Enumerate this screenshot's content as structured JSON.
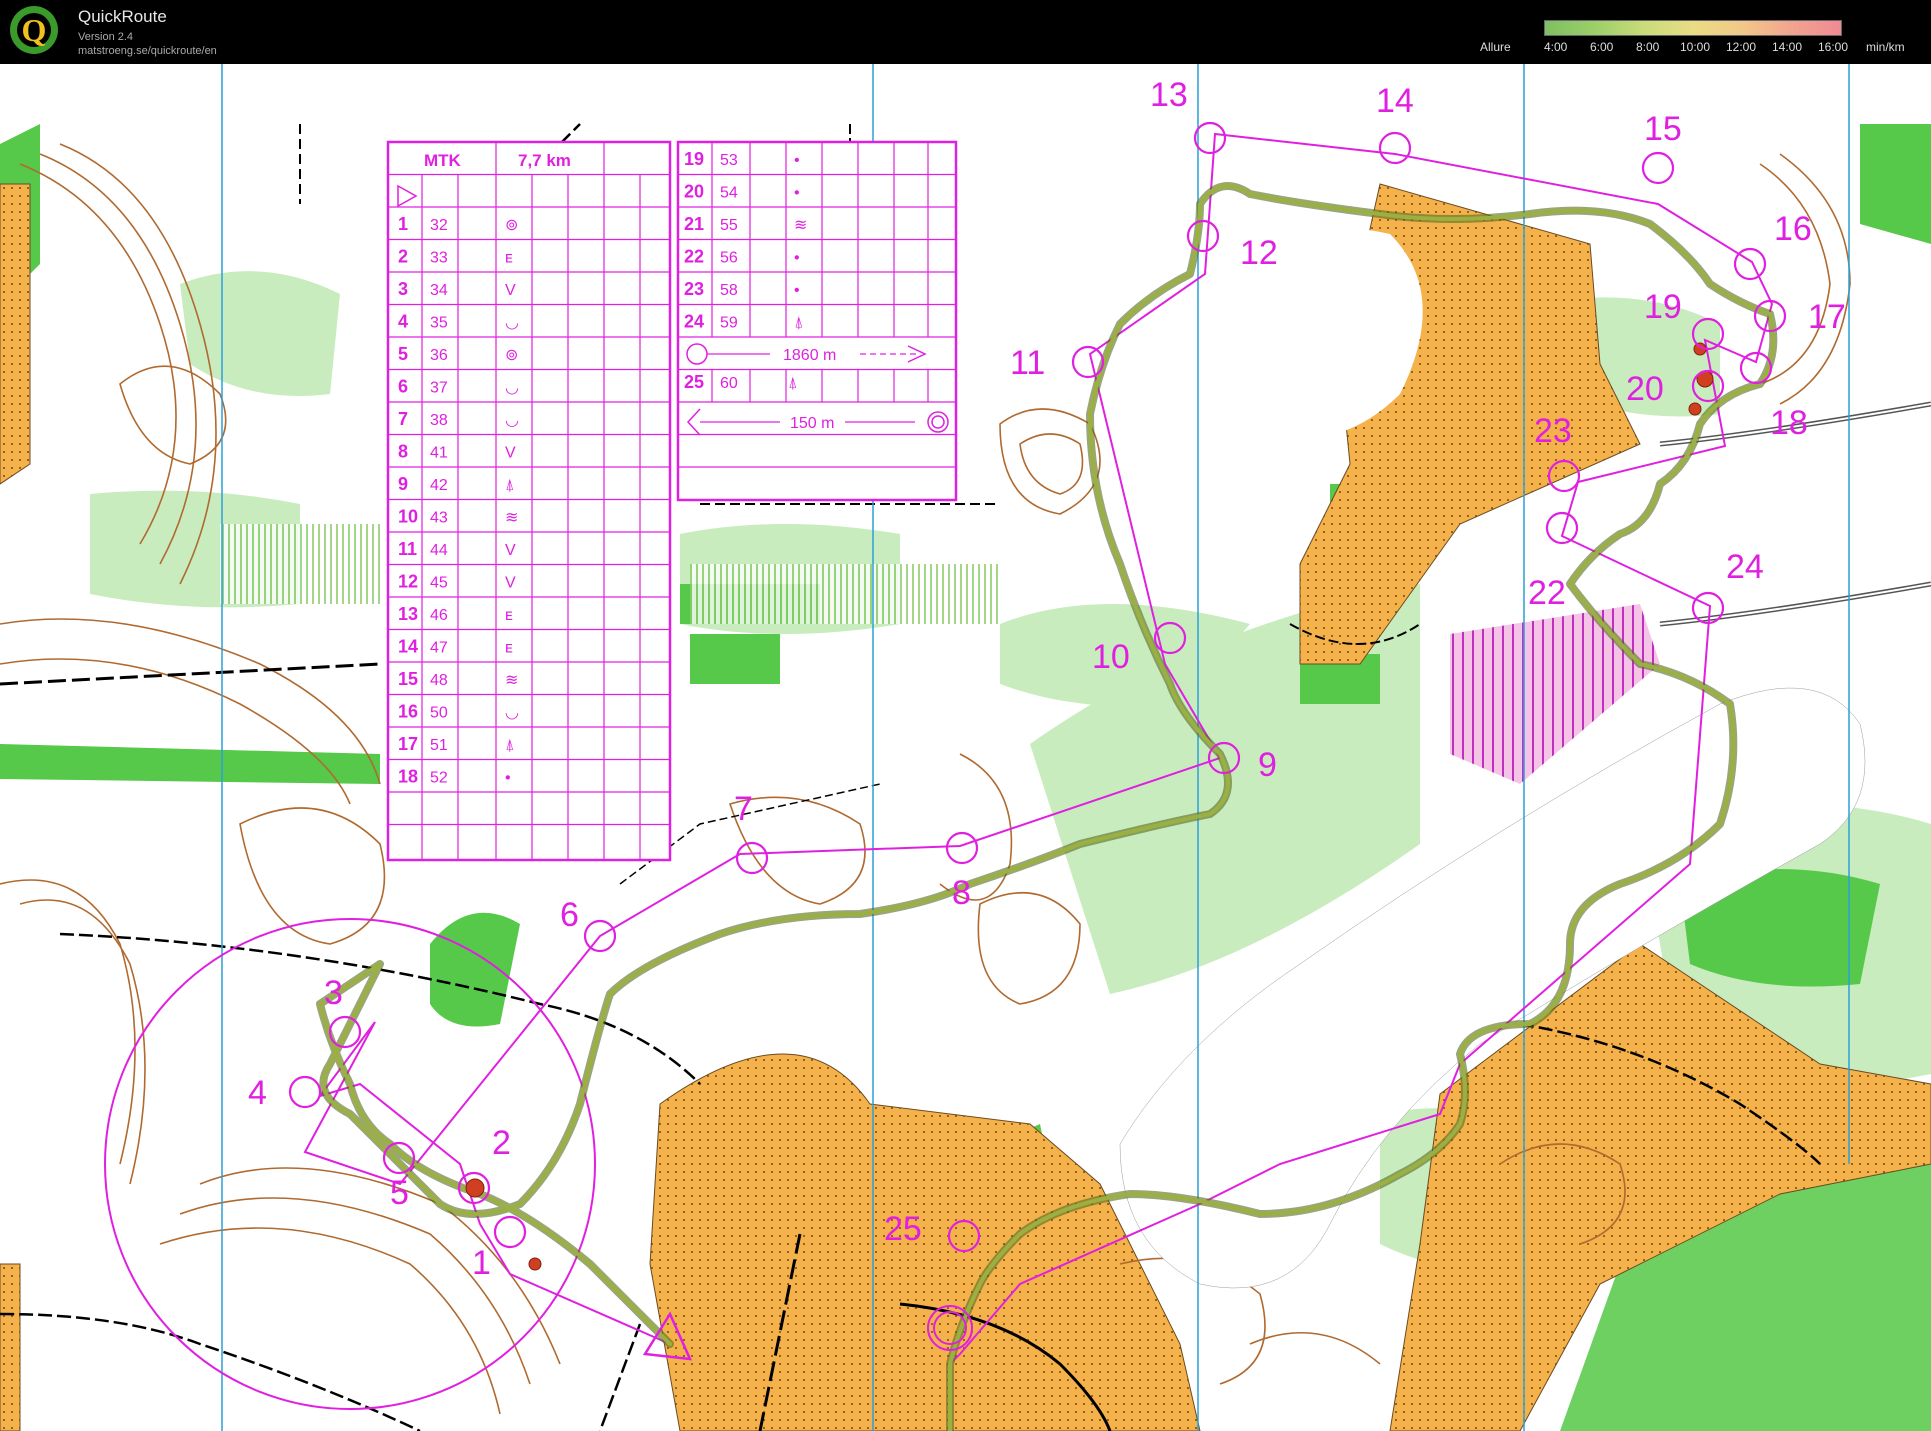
{
  "app": {
    "title": "QuickRoute",
    "version": "Version 2.4",
    "url": "matstroeng.se/quickroute/en",
    "logo_letter": "Q"
  },
  "legend": {
    "label": "Allure",
    "ticks": [
      "4:00",
      "6:00",
      "8:00",
      "10:00",
      "12:00",
      "14:00",
      "16:00"
    ],
    "unit": "min/km"
  },
  "control_card": {
    "header": {
      "class": "MTK",
      "distance": "7,7 km"
    },
    "rows_left": [
      {
        "num": "1",
        "code": "32",
        "sym": "⊚"
      },
      {
        "num": "2",
        "code": "33",
        "sym": "ᴇ"
      },
      {
        "num": "3",
        "code": "34",
        "sym": "V"
      },
      {
        "num": "4",
        "code": "35",
        "sym": "◡"
      },
      {
        "num": "5",
        "code": "36",
        "sym": "⊚"
      },
      {
        "num": "6",
        "code": "37",
        "sym": "◡"
      },
      {
        "num": "7",
        "code": "38",
        "sym": "◡"
      },
      {
        "num": "8",
        "code": "41",
        "sym": "V"
      },
      {
        "num": "9",
        "code": "42",
        "sym": "⍋"
      },
      {
        "num": "10",
        "code": "43",
        "sym": "≋"
      },
      {
        "num": "11",
        "code": "44",
        "sym": "V"
      },
      {
        "num": "12",
        "code": "45",
        "sym": "V"
      },
      {
        "num": "13",
        "code": "46",
        "sym": "ᴇ"
      },
      {
        "num": "14",
        "code": "47",
        "sym": "ᴇ"
      },
      {
        "num": "15",
        "code": "48",
        "sym": "≋"
      },
      {
        "num": "16",
        "code": "50",
        "sym": "◡"
      },
      {
        "num": "17",
        "code": "51",
        "sym": "⍋"
      },
      {
        "num": "18",
        "code": "52",
        "sym": "•"
      }
    ],
    "rows_right": [
      {
        "num": "19",
        "code": "53",
        "sym": "•"
      },
      {
        "num": "20",
        "code": "54",
        "sym": "•"
      },
      {
        "num": "21",
        "code": "55",
        "sym": "≋"
      },
      {
        "num": "22",
        "code": "56",
        "sym": "•"
      },
      {
        "num": "23",
        "code": "58",
        "sym": "•"
      },
      {
        "num": "24",
        "code": "59",
        "sym": "⍋"
      }
    ],
    "marked_route": "1860 m",
    "last_control": {
      "num": "25",
      "code": "60",
      "sym": "⍋"
    },
    "finish_distance": "150 m"
  },
  "controls": [
    {
      "label": "1"
    },
    {
      "label": "2"
    },
    {
      "label": "3"
    },
    {
      "label": "4"
    },
    {
      "label": "5"
    },
    {
      "label": "6"
    },
    {
      "label": "7"
    },
    {
      "label": "8"
    },
    {
      "label": "9"
    },
    {
      "label": "10"
    },
    {
      "label": "11"
    },
    {
      "label": "12"
    },
    {
      "label": "13"
    },
    {
      "label": "14"
    },
    {
      "label": "15"
    },
    {
      "label": "16"
    },
    {
      "label": "17"
    },
    {
      "label": "18"
    },
    {
      "label": "19"
    },
    {
      "label": "20"
    },
    {
      "label": "22"
    },
    {
      "label": "23"
    },
    {
      "label": "24"
    },
    {
      "label": "25"
    }
  ],
  "colors": {
    "course": "#e020e0",
    "route": "#8a9a3a",
    "open_land": "#f7b54a",
    "forest_green": "#55cc44",
    "light_green": "#c8eec0",
    "contour": "#b06a30",
    "water_white": "#ffffff",
    "magnetic_north": "#2aa0d8"
  }
}
